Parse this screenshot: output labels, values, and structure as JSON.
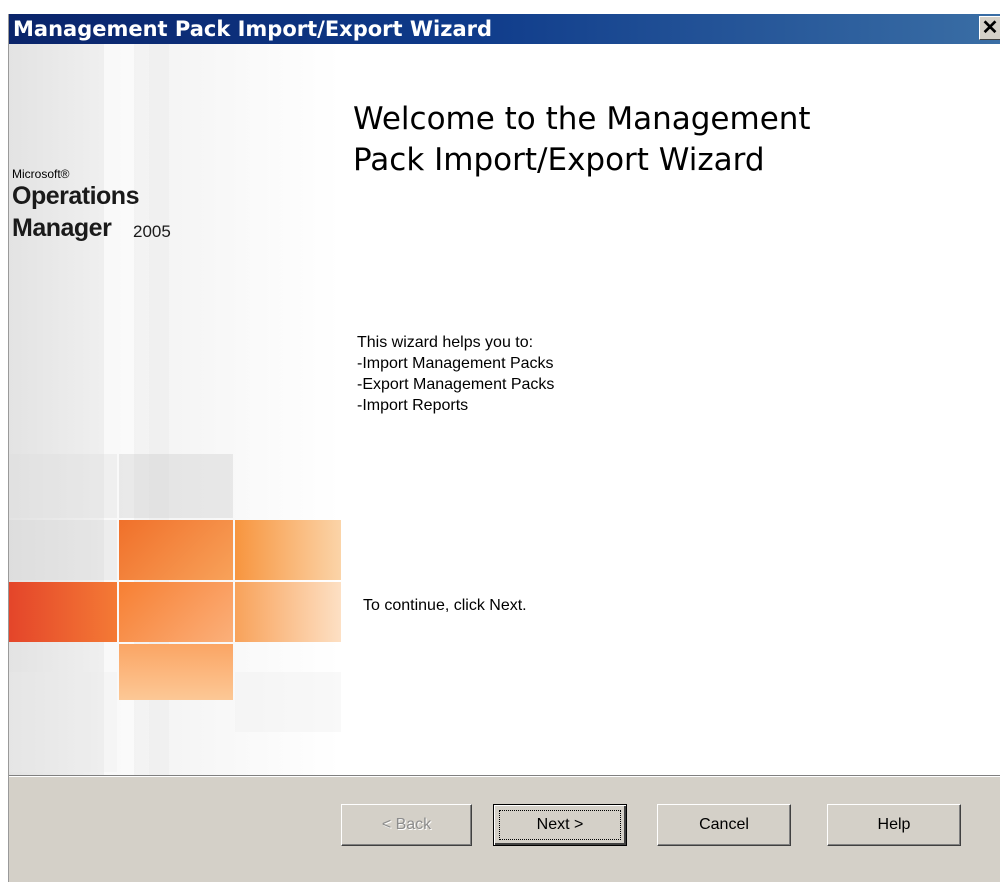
{
  "window": {
    "title": "Management Pack Import/Export Wizard",
    "close_label": "✕"
  },
  "banner": {
    "brand_microsoft": "Microsoft®",
    "brand_line1": "Operations",
    "brand_line2": "Manager",
    "brand_year": "2005"
  },
  "page": {
    "heading_line1": "Welcome to the Management",
    "heading_line2": "Pack Import/Export Wizard",
    "intro": "This wizard helps you to:",
    "bullets": [
      "-Import Management Packs",
      "-Export Management Packs",
      "-Import Reports"
    ],
    "continue": "To continue, click Next."
  },
  "buttons": {
    "back": "< Back",
    "next": "Next >",
    "cancel": "Cancel",
    "help": "Help"
  },
  "colors": {
    "titlebar": "#0a246a",
    "accent_orange": "#f58a3a",
    "dialog_bg": "#d4d0c8"
  }
}
